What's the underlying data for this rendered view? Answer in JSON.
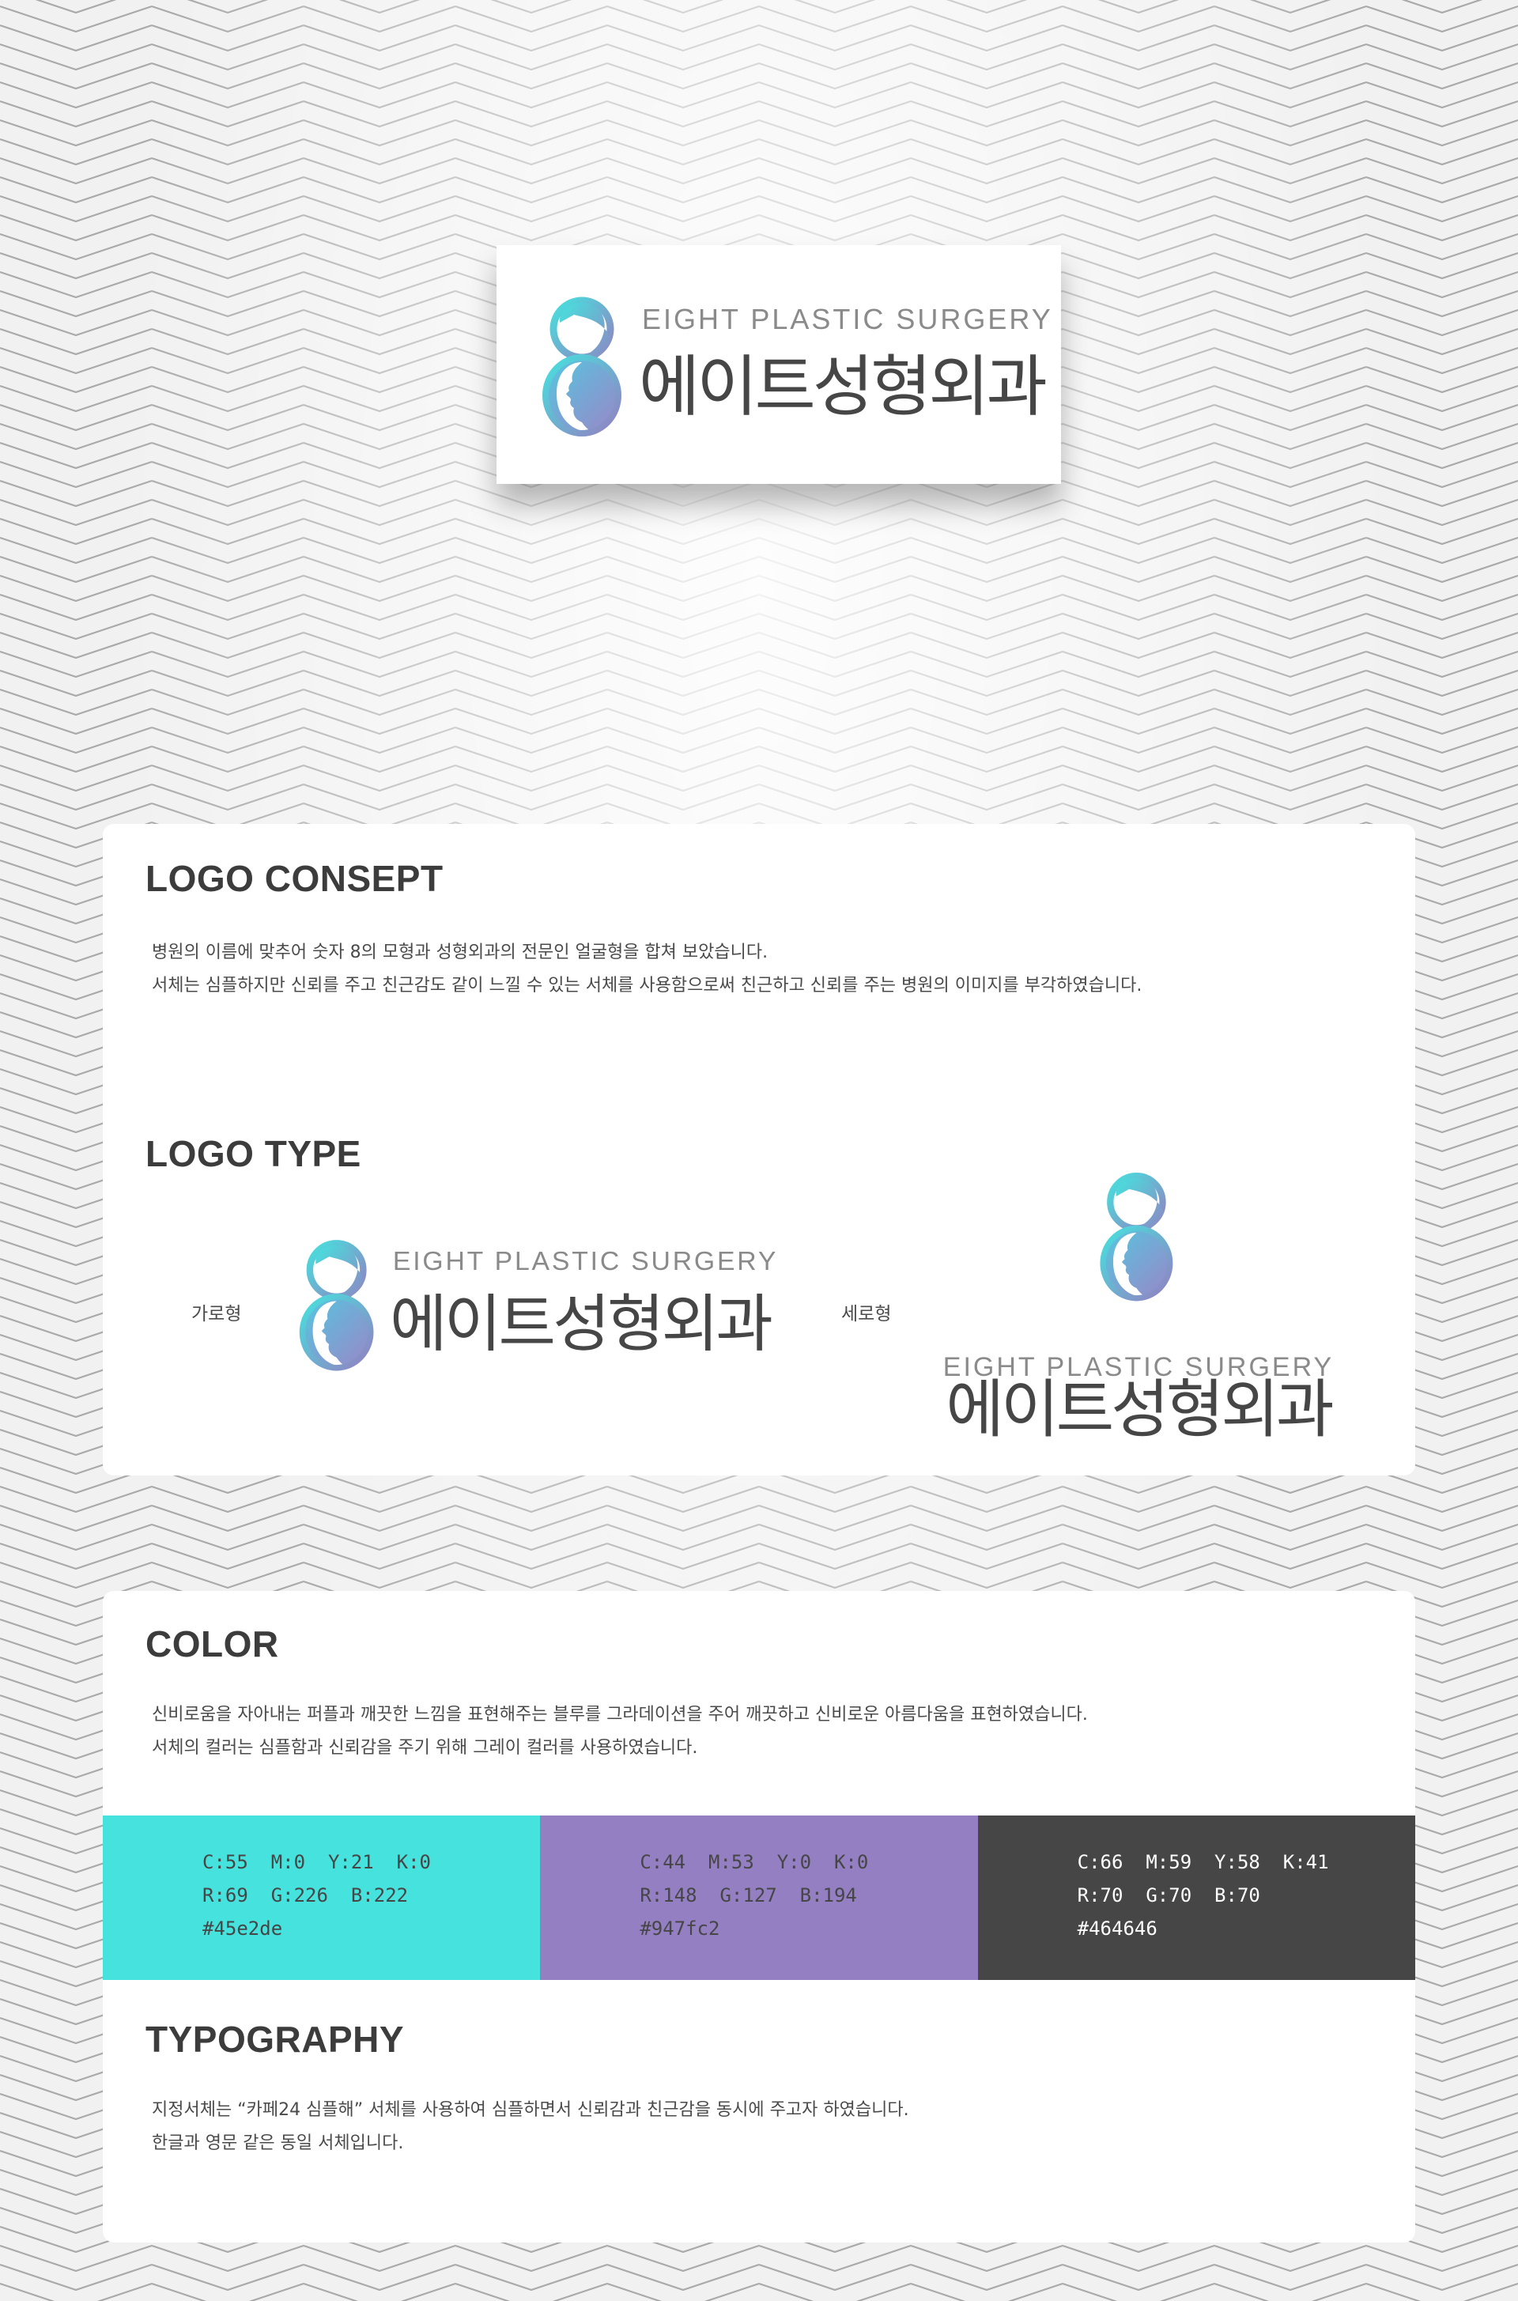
{
  "logo": {
    "english_name": "EIGHT PLASTIC SURGERY",
    "korean_name": "에이트성형외과"
  },
  "colors": {
    "gradient_start": "#45e2de",
    "gradient_end": "#947fc2",
    "text_gray": "#464646"
  },
  "concept": {
    "title": "LOGO CONSEPT",
    "lines": [
      "병원의 이름에 맞추어 숫자 8의 모형과 성형외과의 전문인 얼굴형을 합쳐 보았습니다.",
      "서체는 심플하지만 신뢰를 주고 친근감도 같이 느낄 수 있는 서체를 사용함으로써 친근하고 신뢰를 주는 병원의 이미지를 부각하였습니다."
    ]
  },
  "logo_type": {
    "title": "LOGO TYPE",
    "horizontal_label": "가로형",
    "vertical_label": "세로형"
  },
  "color_section": {
    "title": "COLOR",
    "lines": [
      "신비로움을 자아내는 퍼플과 깨끗한 느낌을 표현해주는 블루를 그라데이션을 주어 깨끗하고 신비로운 아름다움을 표현하였습니다.",
      "서체의 컬러는 심플함과 신뢰감을 주기 위해 그레이 컬러를 사용하였습니다."
    ],
    "swatches": [
      {
        "hex_color": "#45e2de",
        "text_color": "#464646",
        "cmyk": "C:55  M:0  Y:21  K:0",
        "rgb": "R:69  G:226  B:222",
        "hex": "#45e2de"
      },
      {
        "hex_color": "#947fc2",
        "text_color": "#464646",
        "cmyk": "C:44  M:53  Y:0  K:0",
        "rgb": "R:148  G:127  B:194",
        "hex": "#947fc2"
      },
      {
        "hex_color": "#464646",
        "text_color": "#ffffff",
        "cmyk": "C:66  M:59  Y:58  K:41",
        "rgb": "R:70  G:70  B:70",
        "hex": "#464646"
      }
    ]
  },
  "typography": {
    "title": "TYPOGRAPHY",
    "lines": [
      "지정서체는 “카페24 심플해” 서체를 사용하여 심플하면서 신뢰감과 친근감을 동시에 주고자 하였습니다.",
      "한글과 영문 같은 동일 서체입니다."
    ]
  }
}
